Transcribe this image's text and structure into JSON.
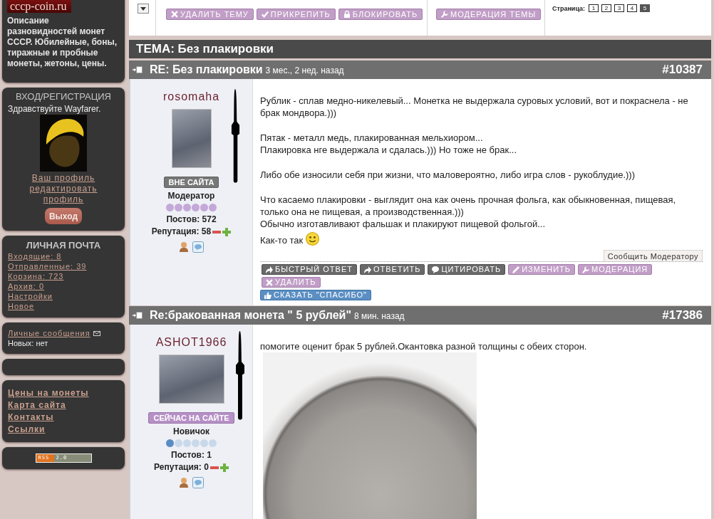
{
  "sidebar": {
    "logo": "cccp-coin.ru",
    "description": "Описание разновидностей монет СССР. Юбилейные, боны, тиражные и пробные монеты, жетоны, цены.",
    "login": {
      "title": "ВХОД/РЕГИСТРАЦИЯ",
      "greeting": "Здравствуйте Wayfarer.",
      "links": [
        "Ваш профиль",
        "редактировать профиль"
      ],
      "logout_button": "Выход"
    },
    "mail": {
      "title": "ЛИЧНАЯ ПОЧТА",
      "links": [
        "Входящие: 8",
        "Отправленные: 39",
        "Корзина: 723",
        "Архив: 0",
        "Настройки",
        "Новое"
      ]
    },
    "messages": {
      "link": "Личные сообщения",
      "status": "Новых: нет"
    },
    "links": [
      "Цены на монеты",
      "Карта сайта",
      "Контакты",
      "Ссылки"
    ],
    "rss": {
      "label": "RSS",
      "version": "2.0"
    }
  },
  "toolbar": {
    "groups": [
      {
        "buttons": [
          {
            "label": "УДАЛИТЬ ТЕМУ",
            "kind": "delete"
          },
          {
            "label": "ПРИКРЕПИТЬ",
            "kind": "pin"
          },
          {
            "label": "БЛОКИРОВАТЬ",
            "kind": "lock"
          }
        ]
      },
      {
        "buttons": [
          {
            "label": "МОДЕРАЦИЯ ТЕМЫ",
            "kind": "moderate"
          }
        ]
      }
    ],
    "pagination": {
      "label": "Страница:",
      "pages": [
        {
          "label": "1",
          "selected": false
        },
        {
          "label": "2",
          "selected": false
        },
        {
          "label": "3",
          "selected": false
        },
        {
          "label": "4",
          "selected": false
        },
        {
          "label": "5",
          "selected": true
        }
      ]
    }
  },
  "topic": {
    "title": "ТЕМА: Без плакировки"
  },
  "posts": [
    {
      "title": "RE: Без плакировки",
      "time": "3 мес., 2 нед. назад",
      "number": "#10387",
      "author": {
        "name": "rosomaha",
        "online": false,
        "status": "ВНЕ САЙТА",
        "role": "Модератор",
        "rank": {
          "stars": 6,
          "color": "#c3a8d8"
        },
        "posts": "Постов: 572",
        "reputation": "Репутация: 58"
      },
      "content": [
        {
          "kind": "text",
          "smiley": true,
          "paragraphs": [
            [
              "Рублик - сплав медно-никелевый... Монетка не выдержала суровых условий, вот и покраснела - не брак мондвора.)))"
            ],
            [
              "Пятак - металл медь, плакированная мельхиором...",
              "Плакировка нге выдержала и сдалась.))) Но тоже не брак..."
            ],
            [
              "Либо обе износили себя при жизни, что маловероятно, либо игра слов - рукоблудие.)))"
            ],
            [
              "Что касаемо плакировки - выглядит она как очень прочная фольга, как обыкновенная, пищевая, только она не пищевая, а производственная.)))",
              "Обычно изготавливают фальшак и плакируют пищевой фольгой...",
              "Как-то так"
            ]
          ]
        }
      ],
      "report_button": "Сообщить Модератору",
      "actions": [
        {
          "label": "БЫСТРЫЙ ОТВЕТ",
          "kind": "reply"
        },
        {
          "label": "ОТВЕТИТЬ",
          "kind": "reply"
        },
        {
          "label": "ЦИТИРОВАТЬ",
          "kind": "quote"
        },
        {
          "label": "ИЗМЕНИТЬ",
          "kind": "edit"
        },
        {
          "label": "МОДЕРАЦИЯ",
          "kind": "moderate"
        },
        {
          "label": "УДАЛИТЬ",
          "kind": "delete"
        }
      ],
      "thanks_button": {
        "label": "СКАЗАТЬ \"СПАСИБО\"",
        "kind": "thanks"
      }
    },
    {
      "title": "Re:бракованная монета \" 5 рублей\"",
      "time": "8 мин. назад",
      "number": "#17386",
      "author": {
        "name": "ASHOT1966",
        "online": true,
        "status": "СЕЙЧАС НА САЙТЕ",
        "role": "Новичок",
        "rank": {
          "stars": 1,
          "color": "#5a8cc4"
        },
        "posts": "Постов: 1",
        "reputation": "Репутация: 0"
      },
      "content": [
        {
          "kind": "text",
          "paragraphs": [
            [
              "помогите оценит брак 5 рублей.Окантовка разной толщины с обеих сторон."
            ]
          ]
        },
        {
          "kind": "photo"
        }
      ]
    }
  ]
}
